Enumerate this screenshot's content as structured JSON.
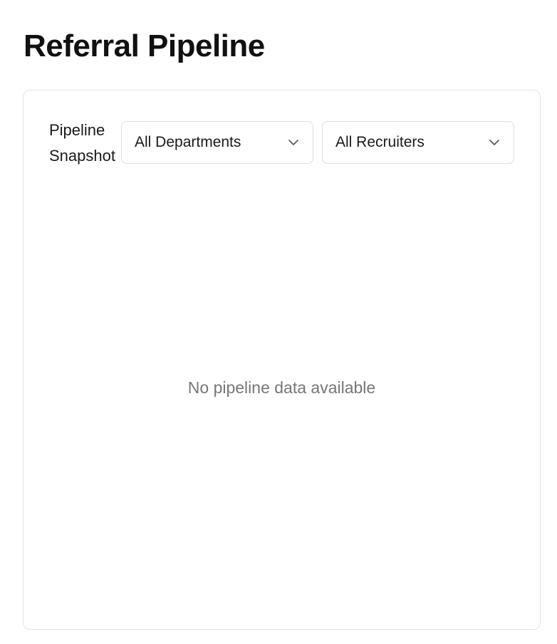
{
  "page": {
    "title": "Referral Pipeline"
  },
  "card": {
    "label_line1": "Pipeline",
    "label_line2": "Snapshot",
    "filters": {
      "department": {
        "selected": "All Departments",
        "icon": "chevron-down-icon"
      },
      "recruiter": {
        "selected": "All Recruiters",
        "icon": "chevron-down-icon"
      }
    },
    "empty_message": "No pipeline data available"
  },
  "colors": {
    "border": "#e4e4e4",
    "muted_text": "#777777",
    "text": "#111111"
  }
}
